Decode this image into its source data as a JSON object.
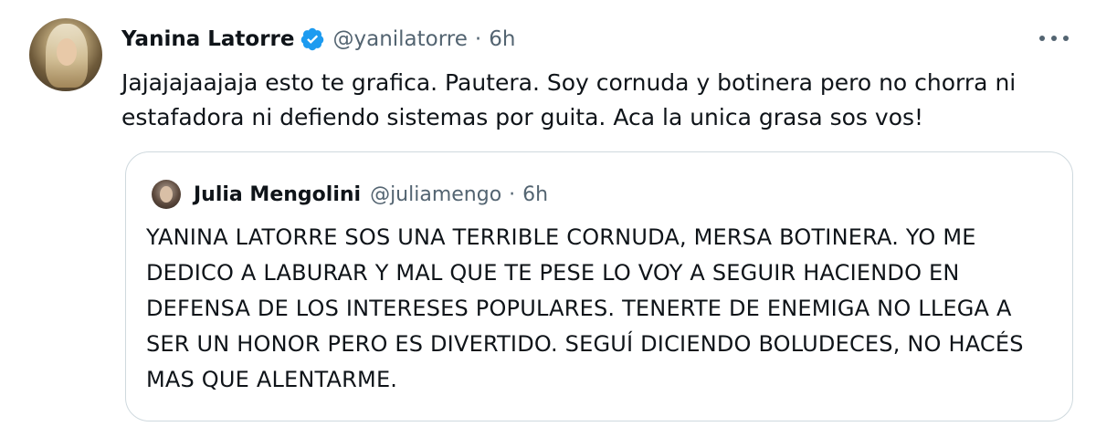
{
  "tweet": {
    "author_name": "Yanina Latorre",
    "handle": "@yanilatorre",
    "separator": "·",
    "time": "6h",
    "text": "Jajajajaajaja esto te grafica. Pautera. Soy cornuda y botinera pero no chorra ni estafadora ni defiendo sistemas por guita. Aca la unica grasa sos vos!",
    "verified_icon": "verified-badge",
    "more_icon": "more-dots"
  },
  "quoted": {
    "author_name": "Julia Mengolini",
    "handle": "@juliamengo",
    "separator": "·",
    "time": "6h",
    "text": "YANINA LATORRE SOS UNA TERRIBLE CORNUDA, MERSA BOTINERA. YO ME DEDICO A LABURAR Y MAL QUE TE PESE LO VOY A SEGUIR HACIENDO EN DEFENSA DE LOS INTERESES POPULARES. TENERTE DE ENEMIGA NO LLEGA A SER UN HONOR PERO ES DIVERTIDO. SEGUÍ DICIENDO BOLUDECES, NO HACÉS MAS QUE ALENTARME."
  },
  "colors": {
    "primary_text": "#0f1419",
    "secondary_text": "#536471",
    "verified_blue": "#1d9bf0",
    "border": "#cfd9de"
  }
}
